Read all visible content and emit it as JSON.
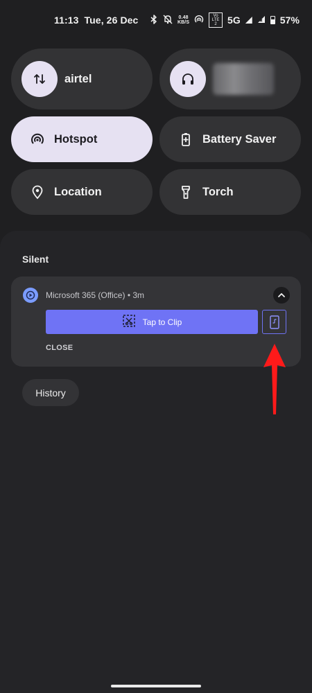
{
  "status_bar": {
    "time": "11:13",
    "date": "Tue, 26 Dec",
    "net_speed_value": "0.48",
    "net_speed_unit": "KB/S",
    "volte_top": "Vo",
    "volte_bottom": "LTE 2",
    "network": "5G",
    "battery": "57%"
  },
  "quick_settings": {
    "tiles": [
      {
        "label": "airtel",
        "icon": "mobile-data-icon",
        "active": false
      },
      {
        "label": "",
        "icon": "headphones-icon",
        "active": false
      },
      {
        "label": "Hotspot",
        "icon": "hotspot-icon",
        "active": true
      },
      {
        "label": "Battery Saver",
        "icon": "battery-saver-icon",
        "active": false
      },
      {
        "label": "Location",
        "icon": "location-pin-icon",
        "active": false
      },
      {
        "label": "Torch",
        "icon": "torch-icon",
        "active": false
      }
    ]
  },
  "notifications": {
    "section_title": "Silent",
    "card": {
      "app_icon": "microsoft-365-icon",
      "app_name": "Microsoft 365 (Office)",
      "separator": "•",
      "time": "3m",
      "primary_action": "Tap to Clip",
      "secondary_action_icon": "phone-screenshot-icon",
      "close_action": "CLOSE"
    },
    "history_button": "History"
  },
  "annotation": {
    "arrow_color": "#ff1a1a"
  },
  "colors": {
    "active_tile": "#e6e1f2",
    "inactive_tile": "#333335",
    "accent": "#6f73f5",
    "app_icon": "#7b9cff"
  }
}
